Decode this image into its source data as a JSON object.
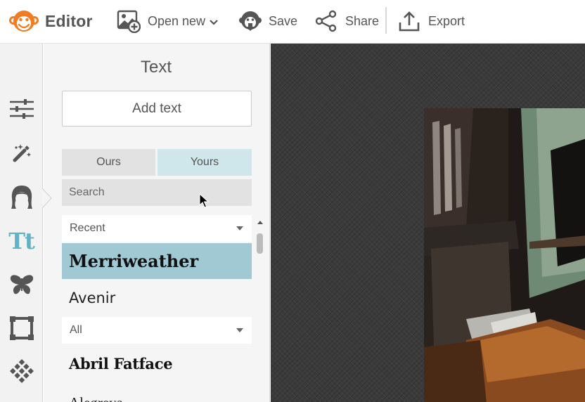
{
  "app": {
    "title": "Editor"
  },
  "toolbar": {
    "open_label": "Open new",
    "save_label": "Save",
    "share_label": "Share",
    "export_label": "Export"
  },
  "rail": {
    "items": [
      {
        "icon": "sliders-icon"
      },
      {
        "icon": "magic-wand-icon"
      },
      {
        "icon": "face-icon"
      },
      {
        "icon": "text-icon",
        "label": "Tt",
        "active": true
      },
      {
        "icon": "butterfly-icon"
      },
      {
        "icon": "frame-icon"
      },
      {
        "icon": "texture-icon"
      }
    ]
  },
  "panel": {
    "title": "Text",
    "add_text_label": "Add text",
    "tabs": [
      {
        "label": "Ours",
        "active": false
      },
      {
        "label": "Yours",
        "active": true
      }
    ],
    "search_placeholder": "Search",
    "recent_label": "Recent",
    "recent_fonts": [
      {
        "name": "Merriweather",
        "selected": true
      },
      {
        "name": "Avenir",
        "selected": false
      }
    ],
    "all_label": "All",
    "all_fonts": [
      {
        "name": "Abril Fatface"
      },
      {
        "name": "Alegreya"
      }
    ]
  },
  "colors": {
    "accent_teal": "#5fb3c4",
    "selected_font_bg": "#a0c9d3",
    "active_tab_bg": "#cfe6ea",
    "logo_orange": "#f07d24",
    "canvas_bg": "#3a3a3a"
  }
}
